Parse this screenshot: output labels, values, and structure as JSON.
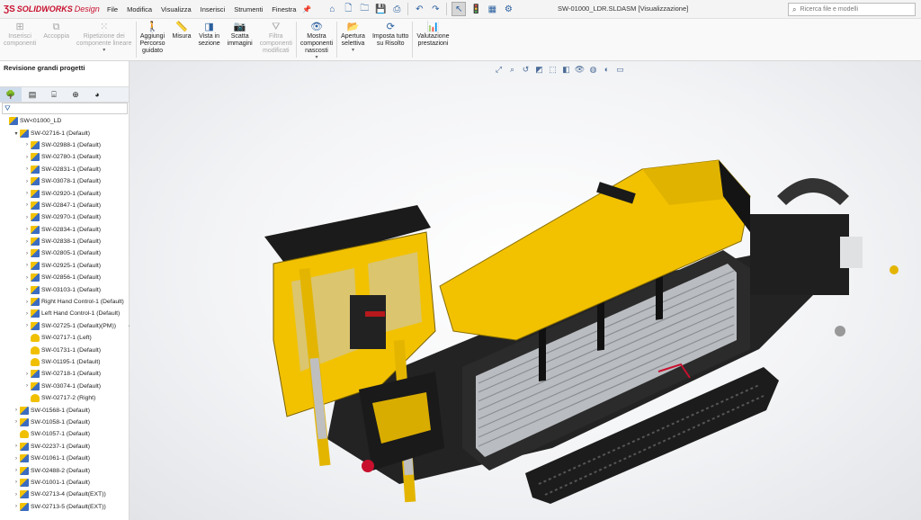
{
  "app": {
    "ds": "ƷS",
    "brand": "SOLIDWORKS",
    "edition": "Design"
  },
  "menu": [
    "File",
    "Modifica",
    "Visualizza",
    "Inserisci",
    "Strumenti",
    "Finestra"
  ],
  "document_title": "SW-01000_LDR.SLDASM [Visualizzazione]",
  "search": {
    "placeholder": "Ricerca file e modelli"
  },
  "ribbon": [
    {
      "label": "Inserisci\ncomponenti",
      "icon": "insert-components-icon",
      "disabled": true
    },
    {
      "label": "Accoppia",
      "icon": "mate-icon",
      "disabled": true
    },
    {
      "label": "Ripetizione dei\ncomponente lineare",
      "icon": "linear-pattern-icon",
      "disabled": true
    },
    {
      "label": "Aggiungi\nPercorso\nguidato",
      "icon": "walkthrough-icon",
      "disabled": false
    },
    {
      "label": "Misura",
      "icon": "measure-icon",
      "disabled": false
    },
    {
      "label": "Vista in\nsezione",
      "icon": "section-view-icon",
      "disabled": false
    },
    {
      "label": "Scatta\nimmagini",
      "icon": "snapshot-icon",
      "disabled": false
    },
    {
      "label": "Filtra\ncomponenti\nmodificati",
      "icon": "filter-modified-icon",
      "disabled": true
    },
    {
      "label": "Mostra\ncomponenti\nnascosti",
      "icon": "show-hidden-icon",
      "disabled": false
    },
    {
      "label": "Apertura\nselettiva",
      "icon": "selective-open-icon",
      "disabled": false
    },
    {
      "label": "Imposta tutto\nsu Risolto",
      "icon": "set-resolved-icon",
      "disabled": false
    },
    {
      "label": "Valutazione\nprestazioni",
      "icon": "performance-icon",
      "disabled": false
    }
  ],
  "pane": {
    "title": "Revisione grandi progetti",
    "tabs": [
      "feature-tree-icon",
      "property-manager-icon",
      "configuration-icon",
      "dimxpert-icon",
      "display-manager-icon"
    ]
  },
  "tree": [
    {
      "label": "SW<01000_LD",
      "level": 0,
      "type": "asm",
      "expander": ""
    },
    {
      "label": "SW-02716-1 (Default)",
      "level": 1,
      "type": "asm",
      "expander": "▾"
    },
    {
      "label": "SW-02988-1 (Default)",
      "level": 2,
      "type": "asm",
      "expander": "›"
    },
    {
      "label": "SW-02780-1 (Default)",
      "level": 2,
      "type": "asm",
      "expander": "›"
    },
    {
      "label": "SW-02831-1 (Default)",
      "level": 2,
      "type": "asm",
      "expander": "›"
    },
    {
      "label": "SW-03078-1 (Default)",
      "level": 2,
      "type": "asm",
      "expander": "›"
    },
    {
      "label": "SW-02920-1 (Default)",
      "level": 2,
      "type": "asm",
      "expander": "›"
    },
    {
      "label": "SW-02847-1 (Default)",
      "level": 2,
      "type": "asm",
      "expander": "›"
    },
    {
      "label": "SW-02970-1 (Default)",
      "level": 2,
      "type": "asm",
      "expander": "›"
    },
    {
      "label": "SW-02834-1 (Default)",
      "level": 2,
      "type": "asm",
      "expander": "›"
    },
    {
      "label": "SW-02838-1 (Default)",
      "level": 2,
      "type": "asm",
      "expander": "›"
    },
    {
      "label": "SW-02805-1 (Default)",
      "level": 2,
      "type": "asm",
      "expander": "›"
    },
    {
      "label": "SW-02925-1 (Default)",
      "level": 2,
      "type": "asm",
      "expander": "›"
    },
    {
      "label": "SW-02856-1 (Default)",
      "level": 2,
      "type": "asm",
      "expander": "›"
    },
    {
      "label": "SW-03103-1 (Default)",
      "level": 2,
      "type": "asm",
      "expander": "›"
    },
    {
      "label": "Right Hand Control-1 (Default)",
      "level": 2,
      "type": "asm",
      "expander": "›"
    },
    {
      "label": "Left Hand Control-1 (Default)",
      "level": 2,
      "type": "asm",
      "expander": "›"
    },
    {
      "label": "SW-02725-1 (Default)(PM))",
      "level": 2,
      "type": "asm",
      "expander": "›"
    },
    {
      "label": "SW-02717-1 (Left)",
      "level": 2,
      "type": "prt",
      "expander": ""
    },
    {
      "label": "SW-01731-1 (Default)",
      "level": 2,
      "type": "prt",
      "expander": ""
    },
    {
      "label": "SW-01195-1 (Default)",
      "level": 2,
      "type": "prt",
      "expander": ""
    },
    {
      "label": "SW-02718-1 (Default)",
      "level": 2,
      "type": "asm",
      "expander": "›"
    },
    {
      "label": "SW-03074-1 (Default)",
      "level": 2,
      "type": "asm",
      "expander": "›"
    },
    {
      "label": "SW-02717-2 (Right)",
      "level": 2,
      "type": "prt",
      "expander": ""
    },
    {
      "label": "SW-01568-1 (Default)",
      "level": 1,
      "type": "asm",
      "expander": "›"
    },
    {
      "label": "SW-01058-1 (Default)",
      "level": 1,
      "type": "asm",
      "expander": "›"
    },
    {
      "label": "SW-01057-1 (Default)",
      "level": 1,
      "type": "prt",
      "expander": ""
    },
    {
      "label": "SW-02237-1 (Default)",
      "level": 1,
      "type": "asm",
      "expander": "›"
    },
    {
      "label": "SW-01061-1 (Default)",
      "level": 1,
      "type": "asm",
      "expander": "›"
    },
    {
      "label": "SW-02488-2 (Default)",
      "level": 1,
      "type": "asm",
      "expander": "›"
    },
    {
      "label": "SW-01001-1 (Default)",
      "level": 1,
      "type": "asm",
      "expander": "›"
    },
    {
      "label": "SW-02713-4 (Default(EXT))",
      "level": 1,
      "type": "asm",
      "expander": "›"
    },
    {
      "label": "SW-02713-5 (Default(EXT))",
      "level": 1,
      "type": "asm",
      "expander": "›"
    }
  ],
  "colors": {
    "machine_yellow": "#f2c200",
    "machine_black": "#1e1e1e",
    "accent_red": "#c8102e"
  }
}
